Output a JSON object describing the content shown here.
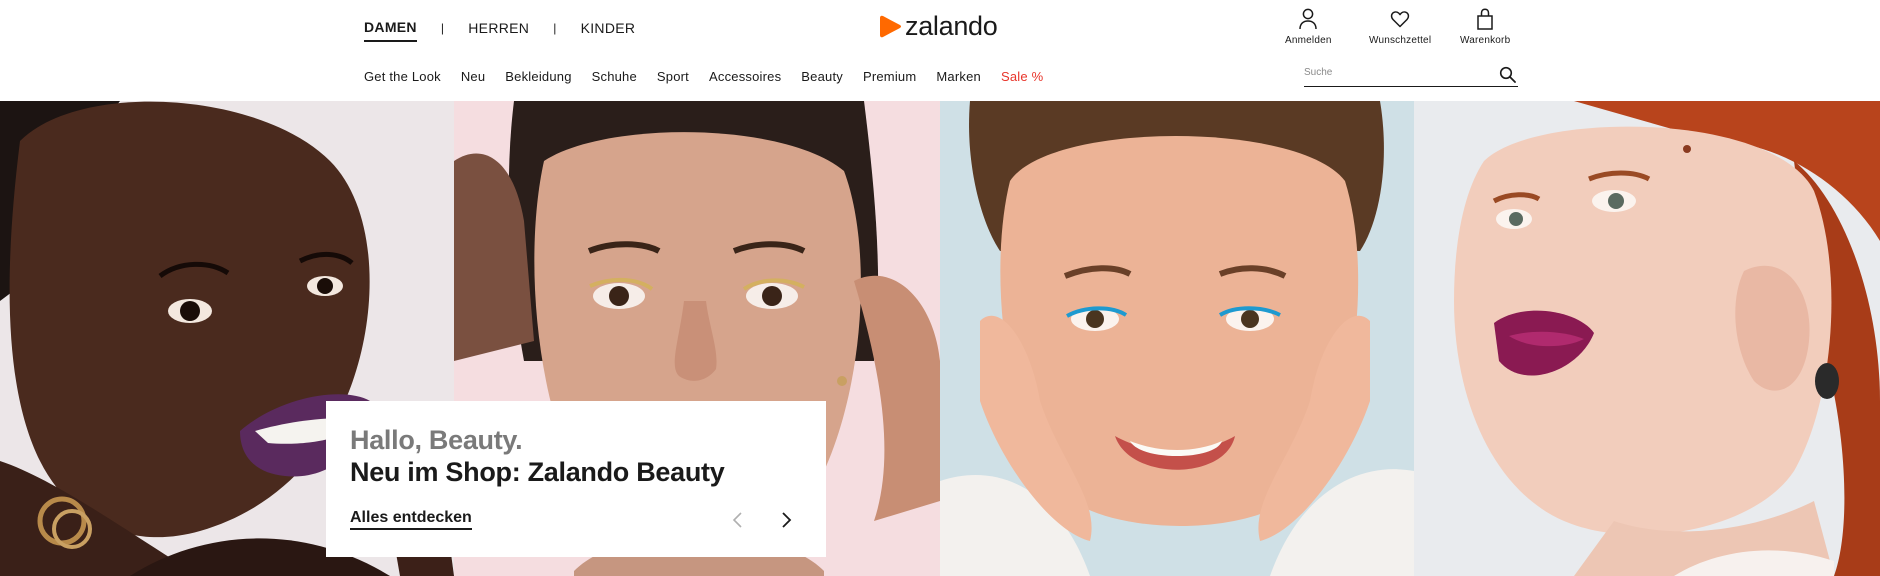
{
  "gender_nav": {
    "items": [
      {
        "label": "DAMEN",
        "active": true
      },
      {
        "label": "HERREN",
        "active": false
      },
      {
        "label": "KINDER",
        "active": false
      }
    ],
    "separator": "|"
  },
  "logo": {
    "text": "zalando",
    "icon": "zalando-play-logo",
    "brand_color": "#ff6900"
  },
  "account_nav": {
    "anmelden": {
      "label": "Anmelden",
      "icon": "user-icon"
    },
    "wunschzettel": {
      "label": "Wunschzettel",
      "icon": "heart-icon"
    },
    "warenkorb": {
      "label": "Warenkorb",
      "icon": "bag-icon"
    }
  },
  "category_nav": {
    "items": [
      {
        "label": "Get the Look"
      },
      {
        "label": "Neu"
      },
      {
        "label": "Bekleidung"
      },
      {
        "label": "Schuhe"
      },
      {
        "label": "Sport"
      },
      {
        "label": "Accessoires"
      },
      {
        "label": "Beauty"
      },
      {
        "label": "Premium"
      },
      {
        "label": "Marken"
      },
      {
        "label": "Sale %"
      }
    ],
    "sale_color": "#e8342a"
  },
  "search": {
    "placeholder": "Suche",
    "value": "",
    "icon": "search-icon"
  },
  "hero": {
    "kicker": "Hallo, Beauty.",
    "headline": "Neu im Shop: Zalando Beauty",
    "cta": "Alles entdecken",
    "prev_icon": "chevron-left-icon",
    "next_icon": "chevron-right-icon",
    "panels": [
      {
        "name": "model-purple-lips",
        "bg": "#ece6e8"
      },
      {
        "name": "model-gold-eyeliner",
        "bg": "#f5dde0"
      },
      {
        "name": "model-blue-eyeliner",
        "bg": "#cfe0e6"
      },
      {
        "name": "model-glitter-lips",
        "bg": "#e9ebee"
      }
    ]
  }
}
